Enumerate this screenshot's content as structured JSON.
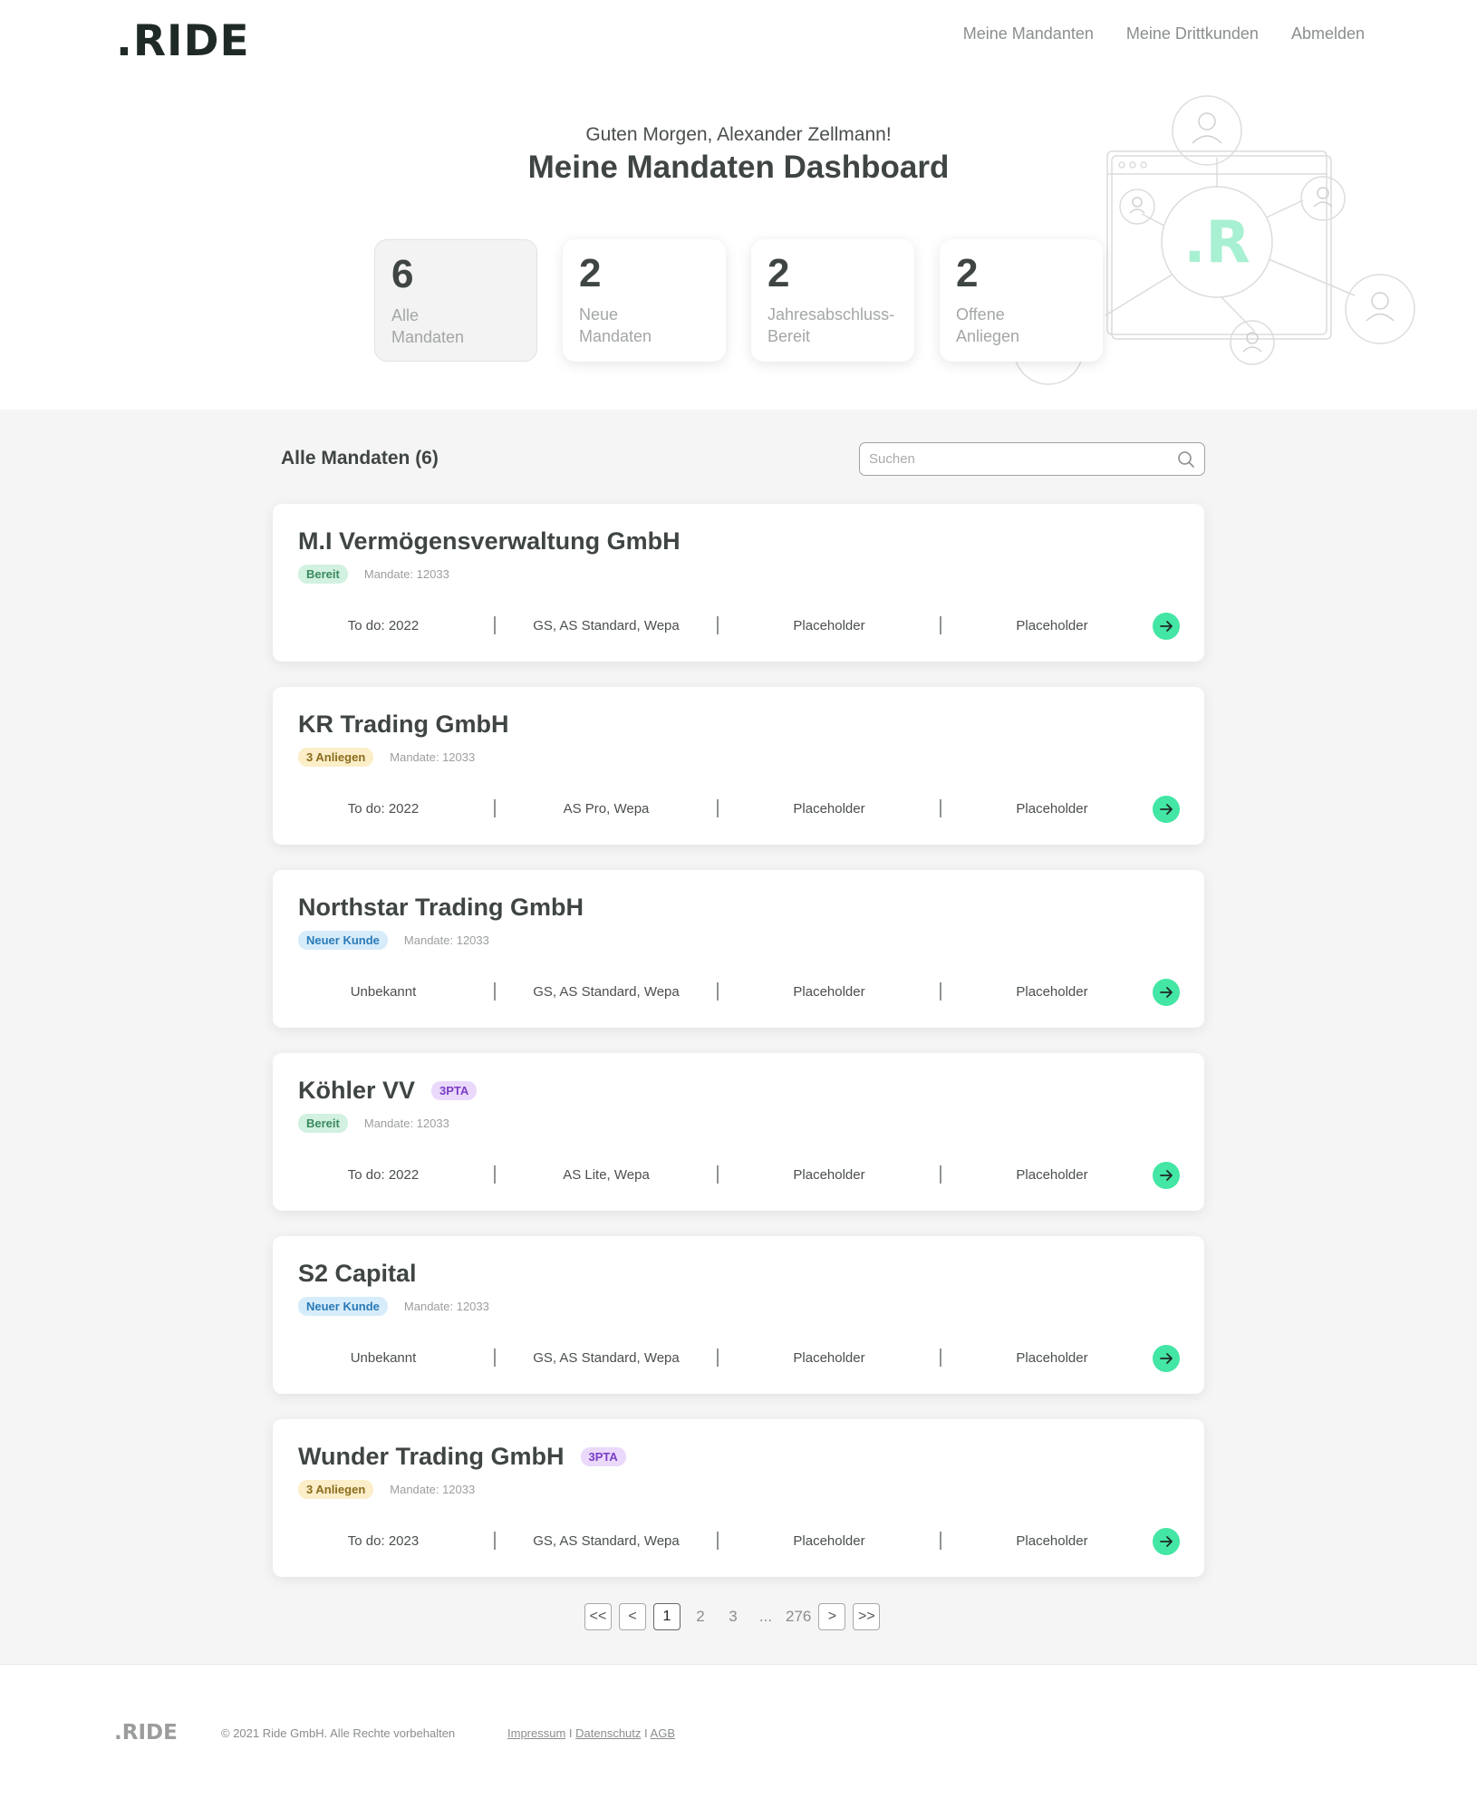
{
  "header": {
    "logo": ".RIDE",
    "nav": [
      "Meine Mandanten",
      "Meine Drittkunden",
      "Abmelden"
    ]
  },
  "hero": {
    "greeting": "Guten Morgen, Alexander Zellmann!",
    "title": "Meine Mandaten Dashboard",
    "illustration_logo": ".R"
  },
  "stats": [
    {
      "value": "6",
      "label_line1": "Alle",
      "label_line2": "Mandaten"
    },
    {
      "value": "2",
      "label_line1": "Neue",
      "label_line2": "Mandaten"
    },
    {
      "value": "2",
      "label_line1": "Jahresabschluss-",
      "label_line2": "Bereit"
    },
    {
      "value": "2",
      "label_line1": "Offene",
      "label_line2": "Anliegen"
    }
  ],
  "list": {
    "header": "Alle Mandaten (6)",
    "search_placeholder": "Suchen"
  },
  "cards": [
    {
      "title": "M.I Vermögensverwaltung GmbH",
      "tag": "",
      "status": "Bereit",
      "mandate": "Mandate: 12033",
      "cols": [
        "To do: 2022",
        "GS, AS Standard, Wepa",
        "Placeholder",
        "Placeholder"
      ]
    },
    {
      "title": "KR Trading GmbH",
      "tag": "",
      "status": "3 Anliegen",
      "mandate": "Mandate: 12033",
      "cols": [
        "To do: 2022",
        "AS Pro, Wepa",
        "Placeholder",
        "Placeholder"
      ]
    },
    {
      "title": "Northstar Trading GmbH",
      "tag": "",
      "status": "Neuer Kunde",
      "mandate": "Mandate: 12033",
      "cols": [
        "Unbekannt",
        "GS, AS Standard, Wepa",
        "Placeholder",
        "Placeholder"
      ]
    },
    {
      "title": "Köhler VV",
      "tag": "3PTA",
      "status": "Bereit",
      "mandate": "Mandate: 12033",
      "cols": [
        "To do: 2022",
        "AS Lite, Wepa",
        "Placeholder",
        "Placeholder"
      ]
    },
    {
      "title": "S2 Capital",
      "tag": "",
      "status": "Neuer Kunde",
      "mandate": "Mandate: 12033",
      "cols": [
        "Unbekannt",
        "GS, AS Standard, Wepa",
        "Placeholder",
        "Placeholder"
      ]
    },
    {
      "title": "Wunder Trading GmbH",
      "tag": "3PTA",
      "status": "3 Anliegen",
      "mandate": "Mandate: 12033",
      "cols": [
        "To do: 2023",
        "GS, AS Standard, Wepa",
        "Placeholder",
        "Placeholder"
      ]
    }
  ],
  "pagination": {
    "first": "<<",
    "prev": "<",
    "current": "1",
    "pages": [
      "2",
      "3"
    ],
    "ellipsis": "...",
    "last_page": "276",
    "next": ">",
    "last": ">>"
  },
  "footer": {
    "logo": ".RIDE",
    "copyright": "© 2021 Ride GmbH. Alle Rechte vorbehalten",
    "links": [
      "Impressum",
      "Datenschutz",
      "AGB"
    ],
    "separator": " I "
  },
  "colors": {
    "accent": "#43e6a4",
    "text": "#3f4543",
    "badge_green": "#d2f1e1",
    "badge_yellow": "#fbeec8",
    "badge_blue": "#d6ecfa",
    "badge_purple": "#ead9fb"
  }
}
